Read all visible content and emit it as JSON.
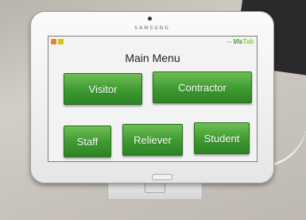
{
  "device": {
    "brand": "SAMSUNG"
  },
  "app": {
    "logo_prefix": "••••",
    "logo_vis": "Vis",
    "logo_tab": "Tab"
  },
  "menu": {
    "title": "Main Menu",
    "buttons": {
      "visitor": "Visitor",
      "contractor": "Contractor",
      "staff": "Staff",
      "reliever": "Reliever",
      "student": "Student"
    }
  },
  "colors": {
    "button_green": "#3d9a30",
    "screen_bg": "#f3f3f3"
  }
}
